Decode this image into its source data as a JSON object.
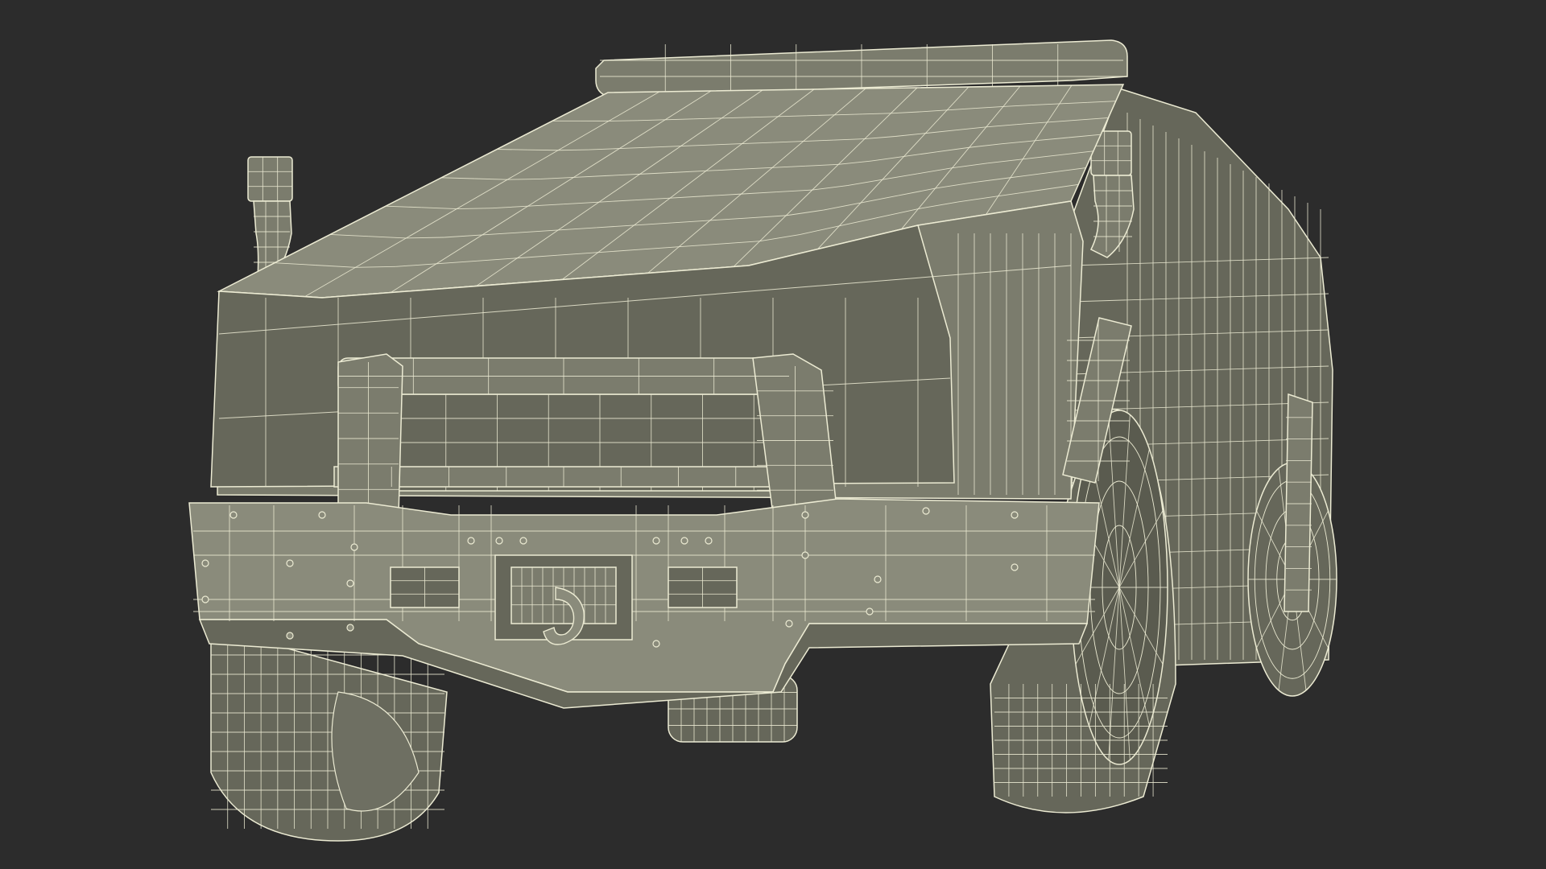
{
  "scene": {
    "subject": "wireframe-vehicle-render",
    "colors": {
      "background": "#2c2c2c",
      "body_fill": "#7b7c6d",
      "body_fill_dark": "#66675a",
      "body_fill_light": "#8a8b7b",
      "wire": "#ecebd3",
      "shadow": "#5a5b4f"
    }
  }
}
